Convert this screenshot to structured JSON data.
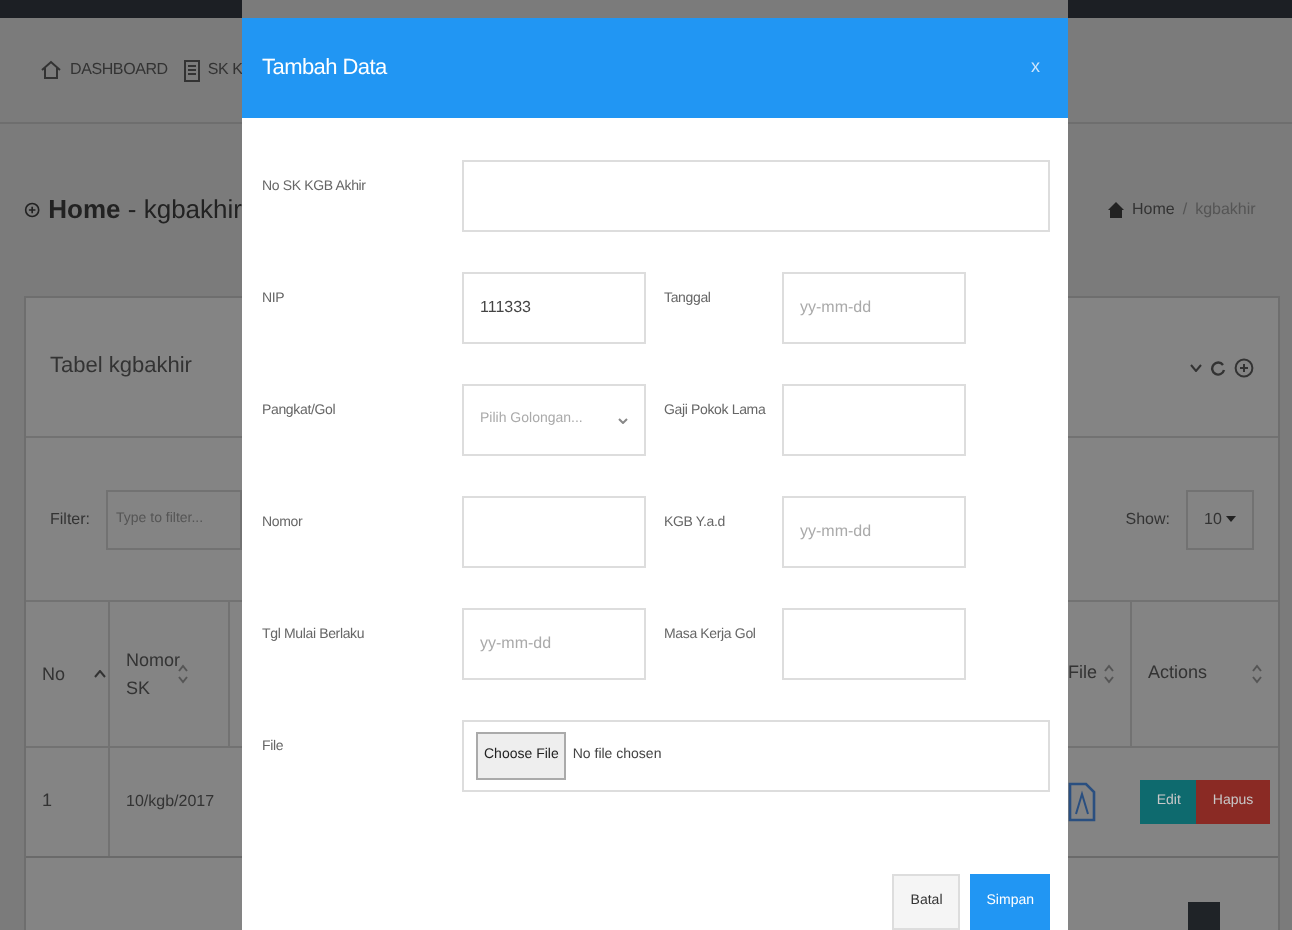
{
  "background_page": {
    "nav": [
      {
        "label": "DASHBOARD"
      },
      {
        "label": "SK K"
      }
    ],
    "page_title": "**Home** - kgbakhir",
    "breadcrumb": [
      "Home",
      "/",
      "kgbakhir"
    ],
    "card_title": "Tabel kgbakhir",
    "filter": {
      "label": "Filter:",
      "placeholder": "Type to filter..."
    },
    "show": {
      "label": "Show:",
      "value": "10"
    },
    "columns_left": [
      {
        "label": "No",
        "sorted": true
      },
      {
        "label": "Nomor SK",
        "sorted": false
      }
    ],
    "columns_right": [
      {
        "label": "File",
        "sorted": false
      },
      {
        "label": "Actions",
        "sorted": false
      }
    ],
    "rows": [
      {
        "no": "1",
        "nomor_sk": "10/kgb/2017",
        "actions": [
          {
            "label": "Edit",
            "kind": "edit"
          },
          {
            "label": "Hapus",
            "kind": "delete"
          }
        ]
      }
    ]
  },
  "modal": {
    "title": "Tambah Data",
    "close": "x",
    "rows": [
      [
        {
          "label": "No SK KGB Akhir",
          "kind": "text",
          "wide": true
        }
      ],
      [
        {
          "label": "NIP",
          "kind": "text",
          "value": "111333"
        },
        {
          "label": "Tanggal",
          "kind": "text",
          "placeholder": "yy-mm-dd"
        }
      ],
      [
        {
          "label": "Pangkat/Gol",
          "kind": "select",
          "placeholder": "Pilih Golongan..."
        },
        {
          "label": "Gaji Pokok Lama",
          "kind": "text"
        }
      ],
      [
        {
          "label": "Nomor",
          "kind": "text"
        },
        {
          "label": "KGB Y.a.d",
          "kind": "text",
          "placeholder": "yy-mm-dd"
        }
      ],
      [
        {
          "label": "Tgl Mulai Berlaku",
          "kind": "text",
          "placeholder": "yy-mm-dd"
        },
        {
          "label": "Masa Kerja Gol",
          "kind": "text"
        }
      ],
      [
        {
          "label": "File",
          "kind": "file",
          "button": "Choose File",
          "status": "No file chosen",
          "wide": true
        }
      ]
    ],
    "buttons": [
      {
        "label": "Batal",
        "kind": "default"
      },
      {
        "label": "Simpan",
        "kind": "primary"
      }
    ]
  }
}
